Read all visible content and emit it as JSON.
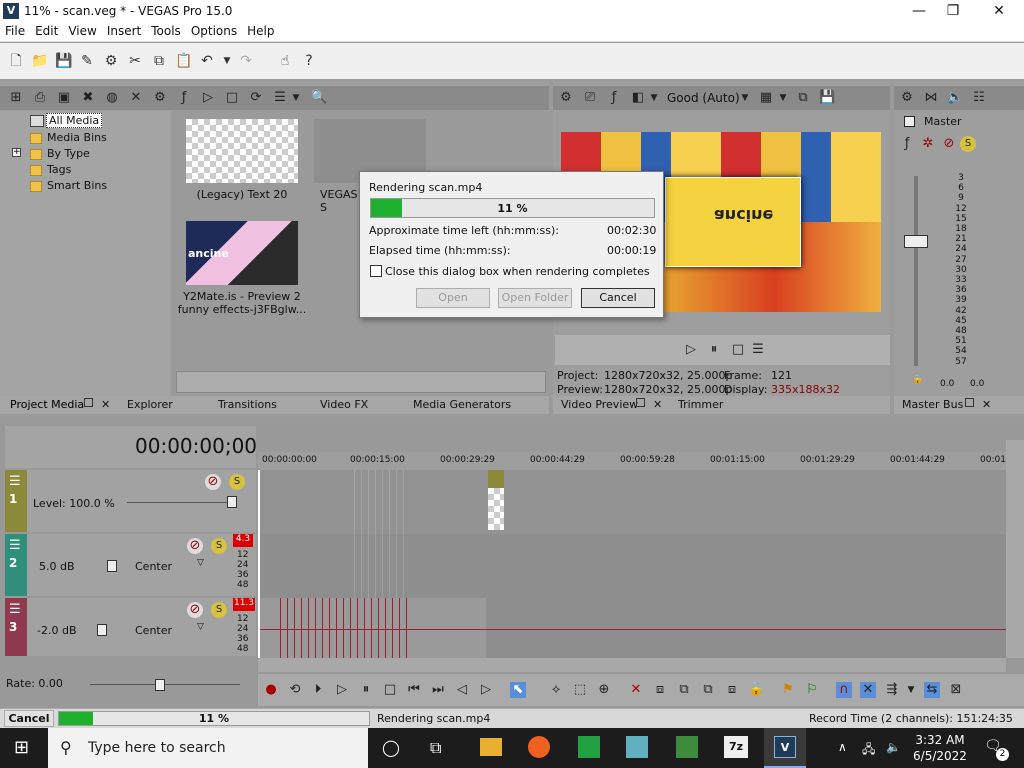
{
  "window": {
    "title": "11% - scan.veg * - VEGAS Pro 15.0",
    "app_icon": "V",
    "minimize": "—",
    "restore": "❐",
    "close": "✕"
  },
  "menu": [
    "File",
    "Edit",
    "View",
    "Insert",
    "Tools",
    "Options",
    "Help"
  ],
  "project_media": {
    "tree": [
      "All Media",
      "Media Bins",
      "By Type",
      "Tags",
      "Smart Bins"
    ],
    "expander": "+",
    "items": [
      {
        "label": "(Legacy) Text 20"
      },
      {
        "label": "VEGAS S"
      },
      {
        "label_line1": "Y2Mate.is - Preview 2",
        "label_line2": "funny effects-j3FBglw..."
      }
    ],
    "thumb_text": "ancine"
  },
  "tabs_left": [
    "Project Media",
    "Explorer",
    "Transitions",
    "Video FX",
    "Media Generators"
  ],
  "preview": {
    "quality": "Good (Auto)",
    "project_label": "Project:",
    "project_value": "1280x720x32, 25.000p",
    "preview_label": "Preview:",
    "preview_value": "1280x720x32, 25.000p",
    "frame_label": "Frame:",
    "frame_value": "121",
    "display_label": "Display:",
    "display_value": "335x188x32",
    "overlay_text": "ancine",
    "tab_video_preview": "Video Preview",
    "tab_trimmer": "Trimmer"
  },
  "master_bus": {
    "title": "Master",
    "scale": [
      "3",
      "6",
      "9",
      "12",
      "15",
      "18",
      "21",
      "24",
      "27",
      "30",
      "33",
      "36",
      "39",
      "42",
      "45",
      "48",
      "51",
      "54",
      "57"
    ],
    "left_value": "0.0",
    "right_value": "0.0",
    "tab": "Master Bus"
  },
  "dialog": {
    "title": "Rendering scan.mp4",
    "progress_text": "11 %",
    "progress": 0.11,
    "time_left_label": "Approximate time left (hh:mm:ss):",
    "time_left_value": "00:02:30",
    "elapsed_label": "Elapsed time (hh:mm:ss):",
    "elapsed_value": "00:00:19",
    "checkbox_label": "Close this dialog box when rendering completes",
    "open_button": "Open",
    "open_folder_button": "Open Folder",
    "cancel_button": "Cancel"
  },
  "timeline": {
    "timecode": "00:00:00;00",
    "ruler": [
      "00:00:00:00",
      "00:00:15:00",
      "00:00:29:29",
      "00:00:44:29",
      "00:00:59:28",
      "00:01:15:00",
      "00:01:29:29",
      "00:01:44:29",
      "00:01:"
    ],
    "tracks": [
      {
        "number": "1",
        "level_label": "Level: 100.0 %",
        "color": "#8a8a3a"
      },
      {
        "number": "2",
        "volume": "5.0 dB",
        "pan": "Center",
        "peak": "4.3",
        "color": "#2f8f7a"
      },
      {
        "number": "3",
        "volume": "-2.0 dB",
        "pan": "Center",
        "peak": "11.3",
        "color": "#8f3a4f"
      }
    ],
    "db_scale": [
      "12",
      "24",
      "36",
      "48"
    ],
    "rate": "Rate: 0.00"
  },
  "status": {
    "cancel": "Cancel",
    "progress_text": "11 %",
    "progress": 0.11,
    "message": "Rendering scan.mp4",
    "record_time": "Record Time (2 channels): 151:24:35"
  },
  "taskbar": {
    "search_placeholder": "Type here to search",
    "time": "3:32 AM",
    "date": "6/5/2022",
    "notifications": "2"
  }
}
